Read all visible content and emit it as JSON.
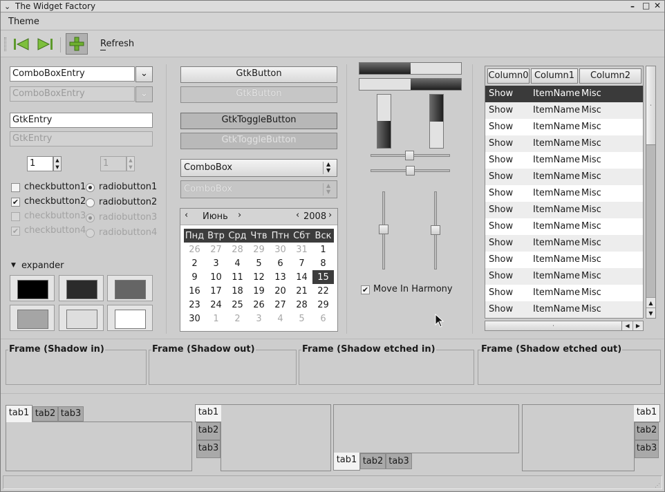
{
  "window": {
    "title": "The Widget Factory"
  },
  "menu": {
    "items": [
      "Theme"
    ]
  },
  "toolbar": {
    "refresh_label": "Refresh"
  },
  "left": {
    "combo_entry": "ComboBoxEntry",
    "combo_entry_disabled": "ComboBoxEntry",
    "entry": "GtkEntry",
    "entry_disabled": "GtkEntry",
    "spin1": "1",
    "spin2": "1",
    "checks": [
      {
        "label": "checkbutton1",
        "checked": false
      },
      {
        "label": "checkbutton2",
        "checked": true
      },
      {
        "label": "checkbutton3",
        "checked": false
      },
      {
        "label": "checkbutton4",
        "checked": true
      }
    ],
    "radios": [
      {
        "label": "radiobutton1",
        "checked": true
      },
      {
        "label": "radiobutton2",
        "checked": false
      },
      {
        "label": "radiobutton3",
        "checked": true
      },
      {
        "label": "radiobutton4",
        "checked": false
      }
    ],
    "expander_label": "expander",
    "swatch_colors": [
      "#000000",
      "#2b2b2b",
      "#656565",
      "#a5a5a5",
      "#dedede",
      "#ffffff"
    ]
  },
  "middle": {
    "button": "GtkButton",
    "button_disabled": "GtkButton",
    "toggle": "GtkToggleButton",
    "toggle_disabled": "GtkToggleButton",
    "combo": "ComboBox",
    "combo_disabled": "ComboBox",
    "calendar": {
      "month": "Июнь",
      "year": "2008",
      "weekdays": [
        "Пнд",
        "Втр",
        "Срд",
        "Чтв",
        "Птн",
        "Сбт",
        "Вск"
      ],
      "rows": [
        [
          "26",
          "27",
          "28",
          "29",
          "30",
          "31",
          "1"
        ],
        [
          "2",
          "3",
          "4",
          "5",
          "6",
          "7",
          "8"
        ],
        [
          "9",
          "10",
          "11",
          "12",
          "13",
          "14",
          "15"
        ],
        [
          "16",
          "17",
          "18",
          "19",
          "20",
          "21",
          "22"
        ],
        [
          "23",
          "24",
          "25",
          "26",
          "27",
          "28",
          "29"
        ],
        [
          "30",
          "1",
          "2",
          "3",
          "4",
          "5",
          "6"
        ]
      ],
      "selected": "15"
    }
  },
  "ranges": {
    "progress_h": [
      0.5,
      0.5
    ],
    "progress_v": [
      0.6,
      0.5
    ],
    "hscale": [
      0.5,
      0.5
    ],
    "vscale": [
      0.5,
      0.5
    ],
    "harmony_label": "Move In Harmony",
    "harmony_checked": true
  },
  "tree": {
    "columns": [
      "Column0",
      "Column1",
      "Column2"
    ],
    "rows": [
      [
        "Show",
        "ItemName",
        "Misc"
      ],
      [
        "Show",
        "ItemName",
        "Misc"
      ],
      [
        "Show",
        "ItemName",
        "Misc"
      ],
      [
        "Show",
        "ItemName",
        "Misc"
      ],
      [
        "Show",
        "ItemName",
        "Misc"
      ],
      [
        "Show",
        "ItemName",
        "Misc"
      ],
      [
        "Show",
        "ItemName",
        "Misc"
      ],
      [
        "Show",
        "ItemName",
        "Misc"
      ],
      [
        "Show",
        "ItemName",
        "Misc"
      ],
      [
        "Show",
        "ItemName",
        "Misc"
      ],
      [
        "Show",
        "ItemName",
        "Misc"
      ],
      [
        "Show",
        "ItemName",
        "Misc"
      ],
      [
        "Show",
        "ItemName",
        "Misc"
      ],
      [
        "Show",
        "ItemName",
        "Misc"
      ]
    ]
  },
  "frames": [
    "Frame (Shadow in)",
    "Frame (Shadow out)",
    "Frame (Shadow etched in)",
    "Frame (Shadow etched out)"
  ],
  "tabs": [
    "tab1",
    "tab2",
    "tab3"
  ]
}
